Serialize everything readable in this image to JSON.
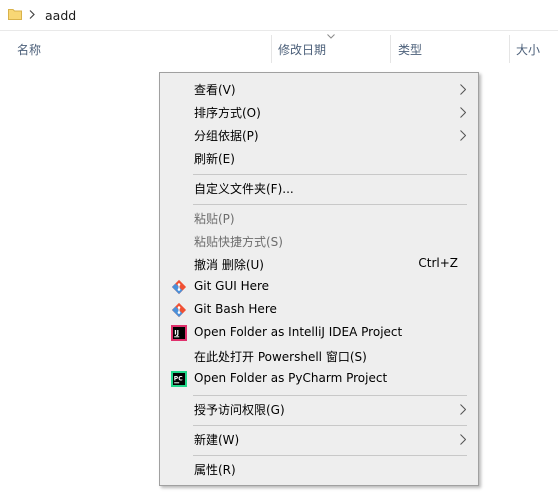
{
  "address_bar": {
    "path": "aadd"
  },
  "columns": [
    {
      "label": "名称"
    },
    {
      "label": "修改日期"
    },
    {
      "label": "类型"
    },
    {
      "label": "大小"
    }
  ],
  "menu": {
    "view": {
      "label": "查看(V)"
    },
    "sort": {
      "label": "排序方式(O)"
    },
    "group": {
      "label": "分组依据(P)"
    },
    "refresh": {
      "label": "刷新(E)"
    },
    "customize": {
      "label": "自定义文件夹(F)..."
    },
    "paste": {
      "label": "粘贴(P)"
    },
    "paste_shortcut": {
      "label": "粘贴快捷方式(S)"
    },
    "undo": {
      "label": "撤消 删除(U)",
      "shortcut": "Ctrl+Z"
    },
    "git_gui": {
      "label": "Git GUI Here",
      "icon": "git-icon"
    },
    "git_bash": {
      "label": "Git Bash Here",
      "icon": "git-icon"
    },
    "intellij": {
      "label": "Open Folder as IntelliJ IDEA Project",
      "icon": "intellij-icon"
    },
    "powershell": {
      "label": "在此处打开 Powershell 窗口(S)"
    },
    "pycharm": {
      "label": "Open Folder as PyCharm Project",
      "icon": "pycharm-icon"
    },
    "access": {
      "label": "授予访问权限(G)"
    },
    "new": {
      "label": "新建(W)"
    },
    "properties": {
      "label": "属性(R)"
    }
  },
  "colors": {
    "menu_bg": "#eeeeee",
    "header_text": "#4c607a",
    "disabled_text": "#6d6d6d",
    "folder_yellow": "#f8d775",
    "git_orange": "#f05033"
  }
}
